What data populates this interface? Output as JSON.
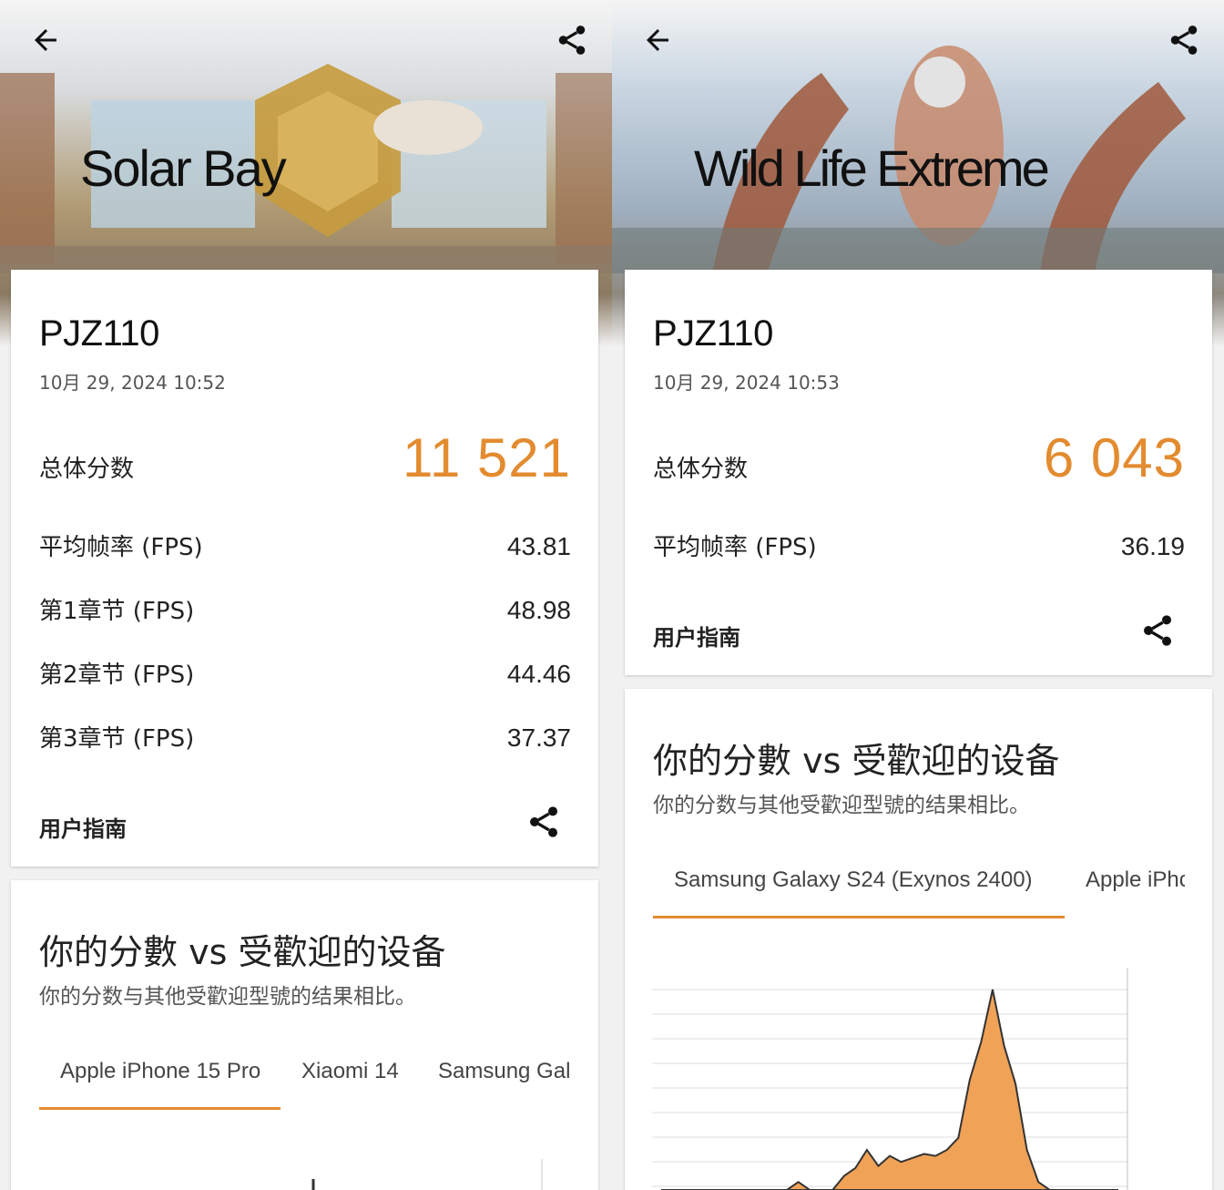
{
  "colors": {
    "accent": "#e38b2f",
    "text": "#222222",
    "muted": "#555555"
  },
  "left": {
    "hero": {
      "title": "Solar Bay"
    },
    "result": {
      "device": "PJZ110",
      "datetime": "10月 29, 2024 10:52",
      "total_label": "总体分数",
      "total_value": "11 521",
      "rows": [
        {
          "label": "平均帧率 (FPS)",
          "value": "43.81"
        },
        {
          "label": "第1章节 (FPS)",
          "value": "48.98"
        },
        {
          "label": "第2章节 (FPS)",
          "value": "44.46"
        },
        {
          "label": "第3章节 (FPS)",
          "value": "37.37"
        }
      ],
      "guide_label": "用户指南"
    },
    "compare": {
      "title": "你的分數 vs 受歡迎的设备",
      "subtitle": "你的分数与其他受歡迎型號的结果相比。",
      "tabs": [
        "Apple iPhone 15 Pro",
        "Xiaomi 14",
        "Samsung Gal"
      ],
      "active_tab": 0
    }
  },
  "right": {
    "hero": {
      "title": "Wild Life Extreme"
    },
    "result": {
      "device": "PJZ110",
      "datetime": "10月 29, 2024 10:53",
      "total_label": "总体分数",
      "total_value": "6 043",
      "rows": [
        {
          "label": "平均帧率 (FPS)",
          "value": "36.19"
        }
      ],
      "guide_label": "用户指南"
    },
    "compare": {
      "title": "你的分數 vs 受歡迎的设备",
      "subtitle": "你的分数与其他受歡迎型號的结果相比。",
      "tabs": [
        "Samsung Galaxy S24 (Exynos 2400)",
        "Apple iPhc"
      ],
      "active_tab": 0
    }
  },
  "icons": {
    "back": "arrow-left-icon",
    "share": "share-icon"
  },
  "chart_data": {
    "type": "area",
    "x": [
      0,
      1,
      2,
      3,
      4,
      5,
      6,
      7,
      8,
      9,
      10,
      11,
      12,
      13,
      14,
      15,
      16,
      17,
      18,
      19,
      20,
      21,
      22,
      23,
      24,
      25,
      26,
      27,
      28,
      29,
      30,
      31,
      32,
      33,
      34,
      35,
      36,
      37,
      38,
      39,
      40
    ],
    "values": [
      0,
      0,
      0,
      0,
      0,
      0,
      0,
      0,
      0,
      0,
      0,
      0,
      0.04,
      0,
      0,
      0,
      0.07,
      0.11,
      0.2,
      0.12,
      0.17,
      0.14,
      0.16,
      0.18,
      0.17,
      0.2,
      0.26,
      0.55,
      0.74,
      1.0,
      0.72,
      0.53,
      0.2,
      0.04,
      0,
      0,
      0,
      0,
      0,
      0,
      0
    ],
    "series_name": "",
    "grid": true,
    "color": "#f0a257"
  }
}
